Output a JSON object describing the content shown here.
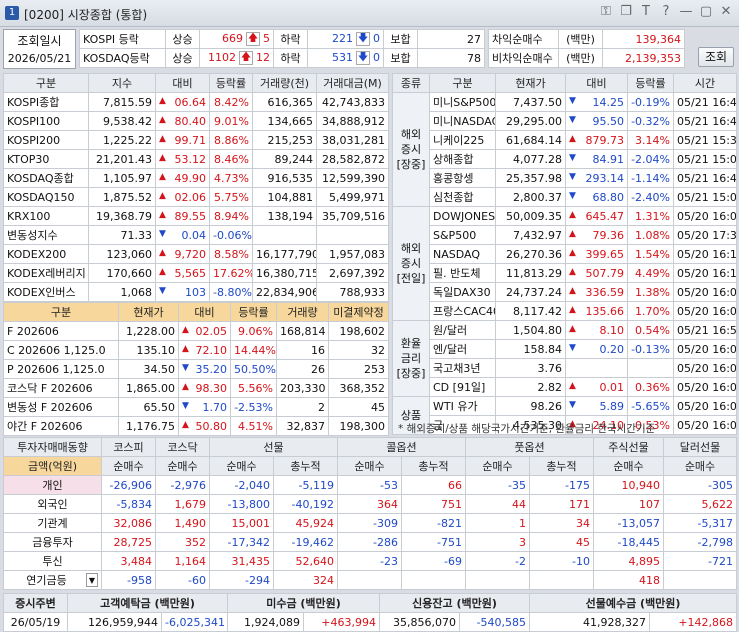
{
  "window": {
    "num": "1",
    "title": "[0200] 시장종합 (통합)"
  },
  "query": {
    "label": "조회일시",
    "date": "2026/05/21",
    "btn": "조회"
  },
  "idx": [
    {
      "name": "KOSPI 등락",
      "s1": "상승",
      "v1": "669",
      "a1": "5",
      "s2": "하락",
      "v2": "221",
      "a2": "0",
      "s3": "보합",
      "v3": "27"
    },
    {
      "name": "KOSDAQ등락",
      "s1": "상승",
      "v1": "1102",
      "a1": "12",
      "s2": "하락",
      "v2": "531",
      "a2": "0",
      "s3": "보합",
      "v3": "78"
    }
  ],
  "arb": [
    {
      "label": "차익순매수",
      "unit": "(백만)",
      "value": "139,364"
    },
    {
      "label": "비차익순매수",
      "unit": "(백만)",
      "value": "2,139,353"
    }
  ],
  "left_top": {
    "headers": [
      "구분",
      "지수",
      "대비",
      "등락률",
      "거래량(천)",
      "거래대금(M)"
    ],
    "rows": [
      [
        "KOSPI종합",
        "7,815.59",
        "up",
        "06.64",
        "8.42%",
        "616,365",
        "42,743,833"
      ],
      [
        "KOSPI100",
        "9,538.42",
        "up",
        "80.40",
        "9.01%",
        "134,665",
        "34,888,912"
      ],
      [
        "KOSPI200",
        "1,225.22",
        "up",
        "99.71",
        "8.86%",
        "215,253",
        "38,031,281"
      ],
      [
        "KTOP30",
        "21,201.43",
        "up",
        "53.12",
        "8.46%",
        "89,244",
        "28,582,872"
      ],
      [
        "KOSDAQ종합",
        "1,105.97",
        "up",
        "49.90",
        "4.73%",
        "916,535",
        "12,599,390"
      ],
      [
        "KOSDAQ150",
        "1,875.52",
        "up",
        "02.06",
        "5.75%",
        "104,881",
        "5,499,971"
      ],
      [
        "KRX100",
        "19,368.79",
        "up",
        "89.55",
        "8.94%",
        "138,194",
        "35,709,516"
      ],
      [
        "변동성지수",
        "71.33",
        "dn",
        "0.04",
        "-0.06%",
        "",
        ""
      ],
      [
        "KODEX200",
        "123,060",
        "up",
        "9,720",
        "8.58%",
        "16,177,790",
        "1,957,083"
      ],
      [
        "KODEX레버리지",
        "170,660",
        "up",
        "5,565",
        "17.62%",
        "16,380,715",
        "2,697,392"
      ],
      [
        "KODEX인버스",
        "1,068",
        "dn",
        "103",
        "-8.80%",
        "22,834,906",
        "788,933"
      ]
    ]
  },
  "left_bot": {
    "headers": [
      "구분",
      "현재가",
      "대비",
      "등락률",
      "거래량",
      "미결제약정"
    ],
    "rows": [
      [
        "F 202606",
        "1,228.00",
        "up",
        "02.05",
        "9.06%",
        "168,814",
        "198,602"
      ],
      [
        "C 202606 1,125.0",
        "135.10",
        "up",
        "72.10",
        "14.44%",
        "16",
        "32"
      ],
      [
        "P 202606 1,125.0",
        "34.50",
        "dn",
        "35.20",
        "50.50%",
        "26",
        "253"
      ],
      [
        "코스닥 F 202606",
        "1,865.00",
        "up",
        "98.30",
        "5.56%",
        "203,330",
        "368,352"
      ],
      [
        "변동성 F 202606",
        "65.50",
        "dn",
        "1.70",
        "-2.53%",
        "2",
        "45"
      ],
      [
        "야간 F 202606",
        "1,176.75",
        "up",
        "50.80",
        "4.51%",
        "32,837",
        "198,300"
      ]
    ]
  },
  "right": {
    "headers": [
      "종류",
      "구분",
      "현재가",
      "대비",
      "등락률",
      "시간"
    ],
    "groups": [
      {
        "cat": "해외 증시 [장중]",
        "rows": [
          [
            "미니S&P500",
            "7,437.50",
            "dn",
            "14.25",
            "-0.19%",
            "05/21",
            "16:49"
          ],
          [
            "미니NASDAQ",
            "29,295.00",
            "dn",
            "95.50",
            "-0.32%",
            "05/21",
            "16:49"
          ],
          [
            "니케이225",
            "61,684.14",
            "up",
            "879.73",
            "3.14%",
            "05/21",
            "15:30"
          ],
          [
            "상해종합",
            "4,077.28",
            "dn",
            "84.91",
            "-2.04%",
            "05/21",
            "15:00"
          ],
          [
            "홍콩항셍",
            "25,357.98",
            "dn",
            "293.14",
            "-1.14%",
            "05/21",
            "16:49"
          ],
          [
            "심천종합",
            "2,800.37",
            "dn",
            "68.80",
            "-2.40%",
            "05/21",
            "15:00"
          ]
        ]
      },
      {
        "cat": "해외 증시 [전일]",
        "rows": [
          [
            "DOWJONES",
            "50,009.35",
            "up",
            "645.47",
            "1.31%",
            "05/20",
            "16:00"
          ],
          [
            "S&P500",
            "7,432.97",
            "up",
            "79.36",
            "1.08%",
            "05/20",
            "17:33"
          ],
          [
            "NASDAQ",
            "26,270.36",
            "up",
            "399.65",
            "1.54%",
            "05/20",
            "16:15"
          ],
          [
            "필. 반도체",
            "11,813.29",
            "up",
            "507.79",
            "4.49%",
            "05/20",
            "16:15"
          ],
          [
            "독일DAX30",
            "24,737.24",
            "up",
            "336.59",
            "1.38%",
            "05/20",
            "16:00"
          ],
          [
            "프랑스CAC40",
            "8,117.42",
            "up",
            "135.66",
            "1.70%",
            "05/20",
            "16:00"
          ]
        ]
      },
      {
        "cat": "환율 금리 [장중]",
        "rows": [
          [
            "원/달러",
            "1,504.80",
            "up",
            "8.10",
            "0.54%",
            "05/21",
            "16:54"
          ],
          [
            "엔/달러",
            "158.84",
            "dn",
            "0.20",
            "-0.13%",
            "05/20",
            "16:00"
          ],
          [
            "국고채3년",
            "3.76",
            "",
            "",
            "",
            "05/20",
            "16:00"
          ],
          [
            "CD [91일]",
            "2.82",
            "up",
            "0.01",
            "0.36%",
            "05/20",
            "16:00"
          ]
        ]
      },
      {
        "cat": "상품",
        "rows": [
          [
            "WTI 유가",
            "98.26",
            "dn",
            "5.89",
            "-5.65%",
            "05/20",
            "16:00"
          ],
          [
            "금",
            "4,535.30",
            "up",
            "24.10",
            "0.53%",
            "05/20",
            "16:00"
          ]
        ]
      }
    ],
    "note": "* 해외증시/상품 해당국가시간기준, 환율금리 한국시간기준"
  },
  "inv": {
    "h1": [
      "투자자매매동향",
      "코스피",
      "코스닥",
      "선물",
      "",
      "콜옵션",
      "",
      "풋옵션",
      "",
      "주식선물",
      "달러선물"
    ],
    "h2": [
      "금액(억원)",
      "순매수",
      "순매수",
      "순매수",
      "총누적",
      "순매수",
      "총누적",
      "순매수",
      "총누적",
      "순매수",
      "순매수"
    ],
    "rows": [
      [
        "개인",
        "-26,906",
        "-2,976",
        "-2,040",
        "-5,119",
        "-53",
        "66",
        "-35",
        "-175",
        "10,940",
        "-305"
      ],
      [
        "외국인",
        "-5,834",
        "1,679",
        "-13,800",
        "-40,192",
        "364",
        "751",
        "44",
        "171",
        "107",
        "5,622"
      ],
      [
        "기관계",
        "32,086",
        "1,490",
        "15,001",
        "45,924",
        "-309",
        "-821",
        "1",
        "34",
        "-13,057",
        "-5,317"
      ],
      [
        "금융투자",
        "28,725",
        "352",
        "-17,342",
        "-19,462",
        "-286",
        "-751",
        "3",
        "45",
        "-18,445",
        "-2,798"
      ],
      [
        "투신",
        "3,484",
        "1,164",
        "31,435",
        "52,640",
        "-23",
        "-69",
        "-2",
        "-10",
        "4,895",
        "-721"
      ],
      [
        "연기금등",
        "-958",
        "-60",
        "-294",
        "324",
        "",
        "",
        "",
        "",
        "418",
        ""
      ]
    ]
  },
  "bottom": {
    "headers": [
      "증시주변",
      "고객예탁금 (백만원)",
      "미수금 (백만원)",
      "신용잔고 (백만원)",
      "선물예수금 (백만원)"
    ],
    "row": [
      "26/05/19",
      "126,959,944",
      "-6,025,341",
      "1,924,089",
      "+463,994",
      "35,856,070",
      "-540,585",
      "41,928,327",
      "+142,868"
    ]
  },
  "colors": {
    "up": "#d4141a",
    "down": "#1f49c8",
    "header": "#e8ebf0",
    "orange": "#f7d79b"
  }
}
